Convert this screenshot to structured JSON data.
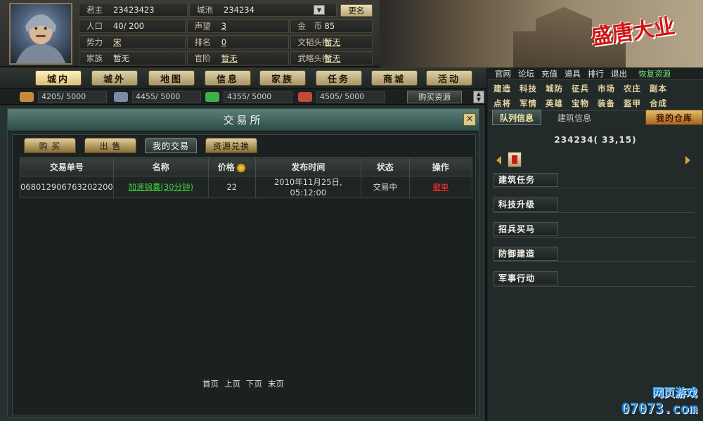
{
  "header": {
    "rows": [
      [
        {
          "label": "君主",
          "value": "23423423"
        },
        {
          "label": "城池",
          "value": "234234"
        }
      ],
      [
        {
          "label": "人口",
          "value": "40/ 200"
        },
        {
          "label": "声望",
          "value": "3"
        },
        {
          "label": "金　币",
          "value": "85"
        }
      ],
      [
        {
          "label": "势力",
          "value": "宋"
        },
        {
          "label": "排名",
          "value": "0"
        },
        {
          "label": "文韬头衔",
          "value": "暂无"
        }
      ],
      [
        {
          "label": "家族",
          "value": "暂无"
        },
        {
          "label": "官阶",
          "value": "暂无"
        },
        {
          "label": "武略头衔",
          "value": "暂无"
        }
      ]
    ],
    "rename_label": "更名",
    "logo_text": "盛唐大业"
  },
  "nav": {
    "items": [
      "城内",
      "城外",
      "地图",
      "信息",
      "家族",
      "任务",
      "商城",
      "活动"
    ]
  },
  "resources": {
    "items": [
      {
        "value": "4205/ 5000",
        "color": "#c98a3a"
      },
      {
        "value": "4455/ 5000",
        "color": "#7a8aa8"
      },
      {
        "value": "4355/ 5000",
        "color": "#3fae4d"
      },
      {
        "value": "4505/ 5000",
        "color": "#c24a3a"
      }
    ],
    "buy_label": "购买资源"
  },
  "exchange": {
    "title": "交易所",
    "tabs": [
      "购 买",
      "出 售",
      "我的交易",
      "资源兑换"
    ],
    "active_tab": 2,
    "columns": [
      "交易单号",
      "名称",
      "价格",
      "发布时间",
      "状态",
      "操作"
    ],
    "rows": [
      {
        "id": "068012906763202200",
        "name": "加速锦囊(30分钟)",
        "price": "22",
        "time": "2010年11月25日, 05:12:00",
        "status": "交易中",
        "op": "撤单"
      }
    ],
    "pager": [
      "首页",
      "上页",
      "下页",
      "末页"
    ]
  },
  "right": {
    "links": [
      "官网",
      "论坛",
      "充值",
      "道具",
      "排行",
      "退出",
      "恢复资源"
    ],
    "functions": [
      "建造",
      "科技",
      "城防",
      "征兵",
      "市场",
      "农庄",
      "副本",
      "点将",
      "军情",
      "英雄",
      "宝物",
      "装备",
      "盔甲",
      "合成"
    ],
    "sub_tabs": [
      "队列信息",
      "建筑信息",
      "我的仓库"
    ],
    "city_coord": "234234( 33,15)",
    "tasks": [
      "建筑任务",
      "科技升级",
      "招兵买马",
      "防御建造",
      "军事行动"
    ],
    "watermark_1": "网页游戏",
    "watermark_2": "07073.com"
  }
}
